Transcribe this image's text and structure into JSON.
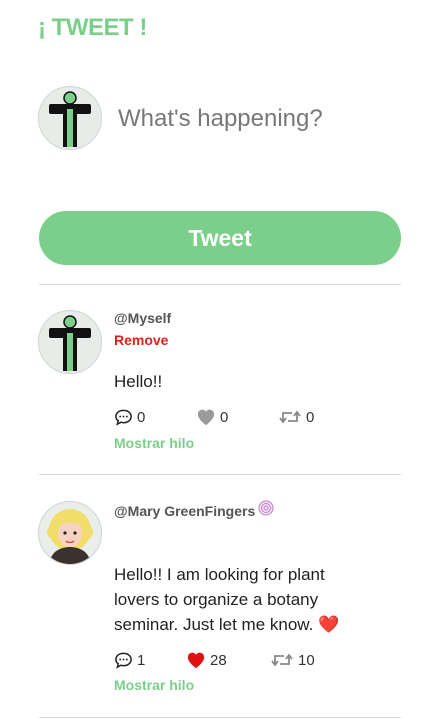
{
  "app": {
    "logo": "¡ TWEET !",
    "accent_color": "#7ccf8a"
  },
  "composer": {
    "avatar_icon": "person-logo-avatar",
    "placeholder": "What's happening?",
    "submit_label": "Tweet"
  },
  "tweets": [
    {
      "handle": "@Myself",
      "remove_label": "Remove",
      "text": "Hello!!",
      "replies": "0",
      "likes": "0",
      "retweets": "0",
      "liked": false,
      "thread_label": "Mostrar hilo"
    },
    {
      "handle": "@Mary GreenFingers",
      "badge_icon": "spiral-badge-icon",
      "text": "Hello!! I am looking for plant lovers to organize a botany seminar. Just let me know.",
      "text_emoji": "❤️",
      "replies": "1",
      "likes": "28",
      "retweets": "10",
      "liked": true,
      "thread_label": "Mostrar hilo"
    }
  ],
  "colors": {
    "like_active": "#e01212",
    "like_inactive": "#9a9a9a",
    "remove": "#e0201b"
  }
}
